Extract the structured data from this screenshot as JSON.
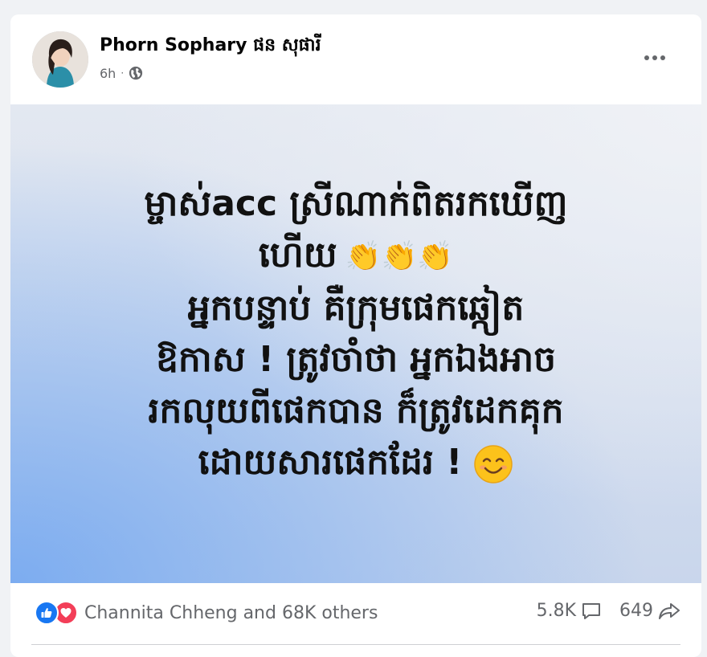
{
  "post": {
    "author": "Phorn Sophary ផន សុផារី",
    "time": "6h",
    "privacy_icon": "globe-icon",
    "more_icon": "more-options-icon"
  },
  "image": {
    "lines": [
      "ម្ចាស់acc ស្រីណាក់ពិតរកឃើញ",
      "ហើយ",
      "អ្នកបន្ទាប់ គឺក្រុមផេកឆ្កៀត",
      "ឱកាស ! ត្រូវចាំថា អ្នកឯងអាច",
      "រកលុយពីផេកបាន ក៏ត្រូវដេកគុក",
      "ដោយសារផេកដែរ !"
    ],
    "clap_emoji": "👏👏👏",
    "smile_emoji": "smiling-face-icon",
    "gradient_colors": [
      "#e3e8f1",
      "#8fb6ef"
    ]
  },
  "footer": {
    "reaction_icons": [
      "like-icon",
      "love-icon"
    ],
    "reaction_text": "Channita Chheng and 68K others",
    "comments": "5.8K",
    "shares": "649"
  },
  "colors": {
    "like": "#1877f2",
    "love": "#f33e58",
    "secondary_text": "#65676b"
  }
}
